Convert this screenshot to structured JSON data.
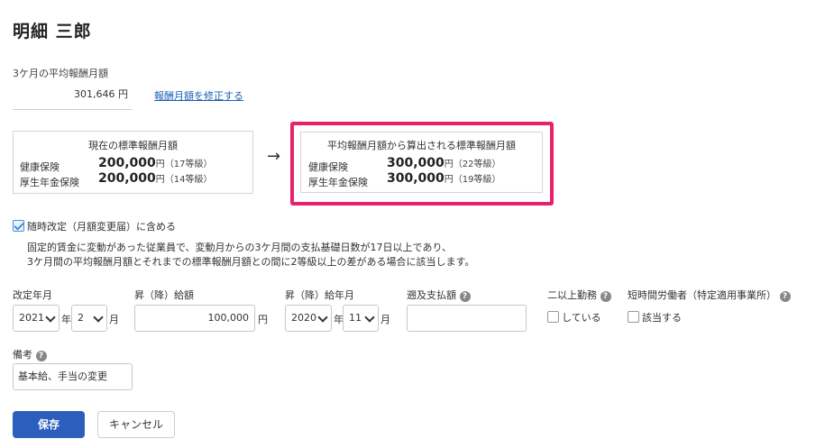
{
  "header": {
    "title": "明細 三郎"
  },
  "average": {
    "label": "3ケ月の平均報酬月額",
    "value": "301,646",
    "unit": "円",
    "edit_link": "報酬月額を修正する"
  },
  "current_box": {
    "title": "現在の標準報酬月額",
    "rows": [
      {
        "label": "健康保険",
        "value": "200,000",
        "unit": "円",
        "grade": "（17等級）"
      },
      {
        "label": "厚生年金保険",
        "value": "200,000",
        "unit": "円",
        "grade": "（14等級）"
      }
    ]
  },
  "calculated_box": {
    "title": "平均報酬月額から算出される標準報酬月額",
    "rows": [
      {
        "label": "健康保険",
        "value": "300,000",
        "unit": "円",
        "grade": "（22等級）"
      },
      {
        "label": "厚生年金保険",
        "value": "300,000",
        "unit": "円",
        "grade": "（19等級）"
      }
    ]
  },
  "arrow": "→",
  "include_check": {
    "label": "随時改定（月額変更届）に含める",
    "checked": true,
    "description_line1": "固定的賃金に変動があった従業員で、変動月からの3ケ月間の支払基礎日数が17日以上であり、",
    "description_line2": "3ケ月間の平均報酬月額とそれまでの標準報酬月額との間に2等級以上の差がある場合に該当します。"
  },
  "revision_date": {
    "label": "改定年月",
    "year": "2021",
    "year_unit": "年",
    "month": "2",
    "month_unit": "月"
  },
  "raise_amount": {
    "label": "昇（降）給額",
    "value": "100,000",
    "unit": "円"
  },
  "raise_date": {
    "label": "昇（降）給年月",
    "year": "2020",
    "year_unit": "年",
    "month": "11",
    "month_unit": "月"
  },
  "retro_pay": {
    "label": "遡及支払額",
    "value": ""
  },
  "multi_work": {
    "label": "二以上勤務",
    "option": "している"
  },
  "short_time": {
    "label": "短時間労働者（特定適用事業所）",
    "option": "該当する"
  },
  "remarks": {
    "label": "備考",
    "value": "基本給、手当の変更"
  },
  "help_glyph": "?",
  "buttons": {
    "save": "保存",
    "cancel": "キャンセル"
  }
}
